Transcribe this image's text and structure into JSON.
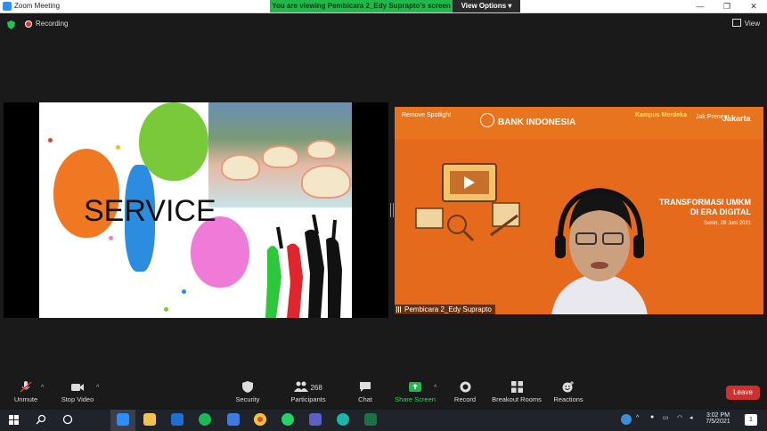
{
  "window": {
    "title": "Zoom Meeting",
    "controls": [
      "—",
      "❐",
      "✕"
    ]
  },
  "banner": {
    "text": "You are viewing Pembicara 2_Edy Suprapto's screen",
    "view_options": "View Options ▾"
  },
  "topbar": {
    "recording_label": "Recording",
    "view_label": "View"
  },
  "shared_screen": {
    "slide_text": "SERVICE"
  },
  "video": {
    "logo_remove_spotlight": "Remove Spotlight",
    "logo_bank": "BANK INDONESIA",
    "logo_kampus": "Kampus Merdeka",
    "logo_jakpreneur": "Jak Preneur",
    "logo_jakarta": "Jakarta",
    "headline_line1": "TRANSFORMASI UMKM",
    "headline_line2": "DI ERA DIGITAL",
    "date": "Senin, 28 Juni 2021",
    "participant_name": "Pembicara 2_Edy Suprapto"
  },
  "toolbar": {
    "unmute": "Unmute",
    "stop_video": "Stop Video",
    "security": "Security",
    "participants": "Participants",
    "participants_count": "268",
    "chat": "Chat",
    "share_screen": "Share Screen",
    "record": "Record",
    "breakout_rooms": "Breakout Rooms",
    "reactions": "Reactions",
    "leave": "Leave"
  },
  "taskbar": {
    "time": "3:02 PM",
    "date": "7/5/2021",
    "notification_count": "1"
  },
  "colors": {
    "share_green": "#1fb84a",
    "leave_red": "#d32e2e",
    "slide_orange": "#e56a1c",
    "zoom_blue": "#2d8cff"
  }
}
